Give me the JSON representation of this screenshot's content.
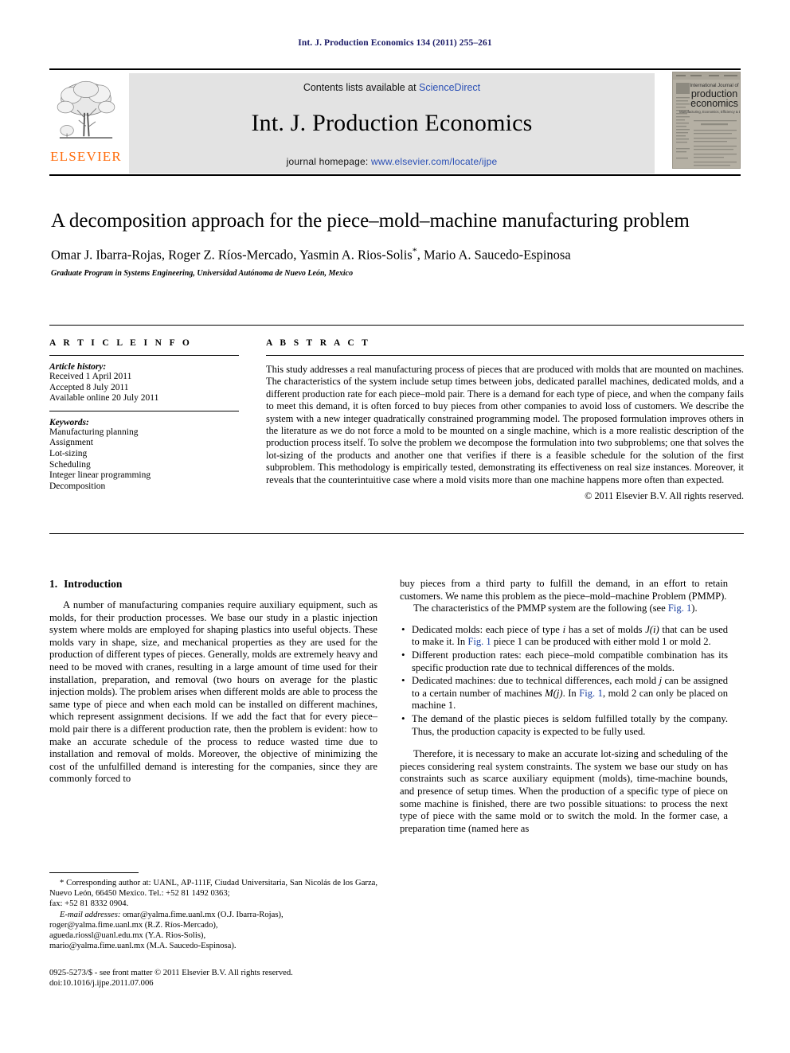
{
  "running_head": "Int. J. Production Economics 134 (2011) 255–261",
  "masthead": {
    "contents_prefix": "Contents lists available at ",
    "contents_link": "ScienceDirect",
    "journal_title": "Int. J. Production Economics",
    "homepage_prefix": "journal homepage: ",
    "homepage_link": "www.elsevier.com/locate/ijpe",
    "publisher_name": "ELSEVIER",
    "cover_title_line1": "International Journal of",
    "cover_title_line2": "production",
    "cover_title_line3": "economics",
    "cover_subtitle": "Manufacturing, Economics, Efficiency & Design"
  },
  "title": "A decomposition approach for the piece–mold–machine manufacturing problem",
  "authors": "Omar J. Ibarra-Rojas, Roger Z. Ríos-Mercado, Yasmin A. Rios-Solis",
  "authors_marker": "*",
  "authors_tail": ", Mario A. Saucedo-Espinosa",
  "affiliation": "Graduate Program in Systems Engineering, Universidad Autónoma de Nuevo León, Mexico",
  "article_info": {
    "heading": "A R T I C L E    I N F O",
    "history_label": "Article history:",
    "history": [
      "Received 1 April 2011",
      "Accepted 8 July 2011",
      "Available online 20 July 2011"
    ],
    "keywords_label": "Keywords:",
    "keywords": [
      "Manufacturing planning",
      "Assignment",
      "Lot-sizing",
      "Scheduling",
      "Integer linear programming",
      "Decomposition"
    ]
  },
  "abstract": {
    "heading": "A B S T R A C T",
    "text": "This study addresses a real manufacturing process of pieces that are produced with molds that are mounted on machines. The characteristics of the system include setup times between jobs, dedicated parallel machines, dedicated molds, and a different production rate for each piece–mold pair. There is a demand for each type of piece, and when the company fails to meet this demand, it is often forced to buy pieces from other companies to avoid loss of customers. We describe the system with a new integer quadratically constrained programming model. The proposed formulation improves others in the literature as we do not force a mold to be mounted on a single machine, which is a more realistic description of the production process itself. To solve the problem we decompose the formulation into two subproblems; one that solves the lot-sizing of the products and another one that verifies if there is a feasible schedule for the solution of the first subproblem. This methodology is empirically tested, demonstrating its effectiveness on real size instances. Moreover, it reveals that the counterintuitive case where a mold visits more than one machine happens more often than expected.",
    "copyright": "© 2011 Elsevier B.V. All rights reserved."
  },
  "section": {
    "number": "1.",
    "title": "Introduction"
  },
  "left_column": {
    "para1": "A number of manufacturing companies require auxiliary equipment, such as molds, for their production processes. We base our study in a plastic injection system where molds are employed for shaping plastics into useful objects. These molds vary in shape, size, and mechanical properties as they are used for the production of different types of pieces. Generally, molds are extremely heavy and need to be moved with cranes, resulting in a large amount of time used for their installation, preparation, and removal (two hours on average for the plastic injection molds). The problem arises when different molds are able to process the same type of piece and when each mold can be installed on different machines, which represent assignment decisions. If we add the fact that for every piece–mold pair there is a different production rate, then the problem is evident: how to make an accurate schedule of the process to reduce wasted time due to installation and removal of molds. Moreover, the objective of minimizing the cost of the unfulfilled demand is interesting for the companies, since they are commonly forced to"
  },
  "right_column": {
    "para1": "buy pieces from a third party to fulfill the demand, in an effort to retain customers. We name this problem as the piece–mold–machine Problem (PMMP).",
    "para2_a": "The characteristics of the PMMP system are the following (see ",
    "para2_link": "Fig. 1",
    "para2_b": ").",
    "bullets": [
      {
        "a": "Dedicated molds: each piece of type ",
        "i1": "i",
        "b": " has a set of molds ",
        "i2": "J(i)",
        "c": " that can be used to make it. In ",
        "link": "Fig. 1",
        "d": " piece 1 can be produced with either mold 1 or mold 2."
      },
      {
        "a": "Different production rates: each piece–mold compatible combination has its specific production rate due to technical differences of the molds.",
        "i1": "",
        "b": "",
        "i2": "",
        "c": "",
        "link": "",
        "d": ""
      },
      {
        "a": "Dedicated machines: due to technical differences, each mold ",
        "i1": "j",
        "b": " can be assigned to a certain number of machines ",
        "i2": "M(j)",
        "c": ". In ",
        "link": "Fig. 1",
        "d": ", mold 2 can only be placed on machine 1."
      },
      {
        "a": "The demand of the plastic pieces is seldom fulfilled totally by the company. Thus, the production capacity is expected to be fully used.",
        "i1": "",
        "b": "",
        "i2": "",
        "c": "",
        "link": "",
        "d": ""
      }
    ],
    "para3": "Therefore, it is necessary to make an accurate lot-sizing and scheduling of the pieces considering real system constraints. The system we base our study on has constraints such as scarce auxiliary equipment (molds), time-machine bounds, and presence of setup times. When the production of a specific type of piece on some machine is finished, there are two possible situations: to process the next type of piece with the same mold or to switch the mold. In the former case, a preparation time (named here as"
  },
  "footnotes": {
    "corresponding": "* Corresponding author at: UANL, AP-111F, Ciudad Universitaria, San Nicolás de los Garza, Nuevo León, 66450 Mexico. Tel.: +52 81 1492 0363;",
    "fax": "fax: +52 81 8332 0904.",
    "email_label": "E-mail addresses:",
    "emails": [
      "omar@yalma.fime.uanl.mx (O.J. Ibarra-Rojas),",
      "roger@yalma.fime.uanl.mx (R.Z. Ríos-Mercado),",
      "agueda.riossl@uanl.edu.mx (Y.A. Rios-Solis),",
      "mario@yalma.fime.uanl.mx (M.A. Saucedo-Espinosa)."
    ]
  },
  "issn_line": "0925-5273/$ - see front matter © 2011 Elsevier B.V. All rights reserved.",
  "doi_line": "doi:10.1016/j.ijpe.2011.07.006",
  "colors": {
    "link_blue": "#2a4fb5",
    "ref_blue": "#1a3fa0",
    "running_head_blue": "#1a1a66",
    "elsevier_orange": "#ff6c0c",
    "panel_gray": "#e3e3e3"
  }
}
